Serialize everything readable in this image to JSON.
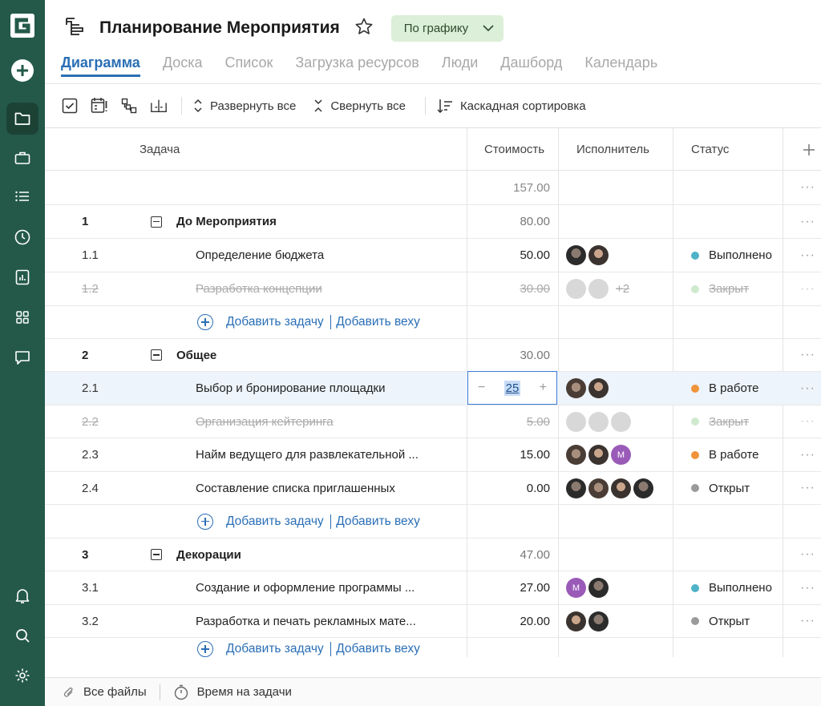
{
  "sidebar": {
    "logo_letter": "G",
    "items": [
      {
        "name": "add-icon"
      },
      {
        "name": "folder-icon",
        "active": true
      },
      {
        "name": "briefcase-icon"
      },
      {
        "name": "list-icon"
      },
      {
        "name": "clock-icon"
      },
      {
        "name": "report-icon"
      },
      {
        "name": "grid-icon"
      },
      {
        "name": "chat-icon"
      },
      {
        "name": "bell-icon"
      },
      {
        "name": "search-icon"
      },
      {
        "name": "settings-icon"
      }
    ]
  },
  "header": {
    "title": "Планирование Мероприятия",
    "status_dropdown": "По графику",
    "tabs": [
      "Диаграмма",
      "Доска",
      "Список",
      "Загрузка ресурсов",
      "Люди",
      "Дашборд",
      "Календарь"
    ],
    "active_tab": "Диаграмма"
  },
  "toolbar": {
    "expand_all": "Развернуть все",
    "collapse_all": "Свернуть все",
    "cascade_sort": "Каскадная сортировка"
  },
  "table": {
    "columns": {
      "task": "Задача",
      "cost": "Стоимость",
      "assignee": "Исполнитель",
      "status": "Статус"
    },
    "total_cost": "157.00",
    "add_task": "Добавить задачу",
    "add_milestone": "Добавить веху",
    "rows": [
      {
        "num": "1",
        "name": "До Мероприятия",
        "cost": "80.00",
        "group": true
      },
      {
        "num": "1.1",
        "name": "Определение бюджета",
        "cost": "50.00",
        "status": "Выполнено",
        "status_color": "#4fb3c8"
      },
      {
        "num": "1.2",
        "name": "Разработка концепции",
        "cost": "30.00",
        "status": "Закрыт",
        "status_color": "#cfe9cf",
        "closed": true,
        "extra": "+2"
      },
      {
        "num": "2",
        "name": "Общее",
        "cost": "30.00",
        "group": true
      },
      {
        "num": "2.1",
        "name": "Выбор и бронирование площадки",
        "cost": "25",
        "status": "В работе",
        "status_color": "#f0933a",
        "editing": true
      },
      {
        "num": "2.2",
        "name": "Организация кейтеринга",
        "cost": "5.00",
        "status": "Закрыт",
        "status_color": "#cfe9cf",
        "closed": true
      },
      {
        "num": "2.3",
        "name": "Найм ведущего для развлекательной ...",
        "cost": "15.00",
        "status": "В работе",
        "status_color": "#f0933a"
      },
      {
        "num": "2.4",
        "name": "Составление списка приглашенных",
        "cost": "0.00",
        "status": "Открыт",
        "status_color": "#9a9a9a"
      },
      {
        "num": "3",
        "name": "Декорации",
        "cost": "47.00",
        "group": true
      },
      {
        "num": "3.1",
        "name": "Создание и оформление программы ...",
        "cost": "27.00",
        "status": "Выполнено",
        "status_color": "#4fb3c8"
      },
      {
        "num": "3.2",
        "name": "Разработка и печать рекламных мате...",
        "cost": "20.00",
        "status": "Открыт",
        "status_color": "#9a9a9a"
      }
    ],
    "avatar_letter": "M",
    "stepper_minus": "−",
    "stepper_plus": "+",
    "more": "···"
  },
  "footer": {
    "all_files": "Все файлы",
    "time_on_tasks": "Время на задачи"
  }
}
